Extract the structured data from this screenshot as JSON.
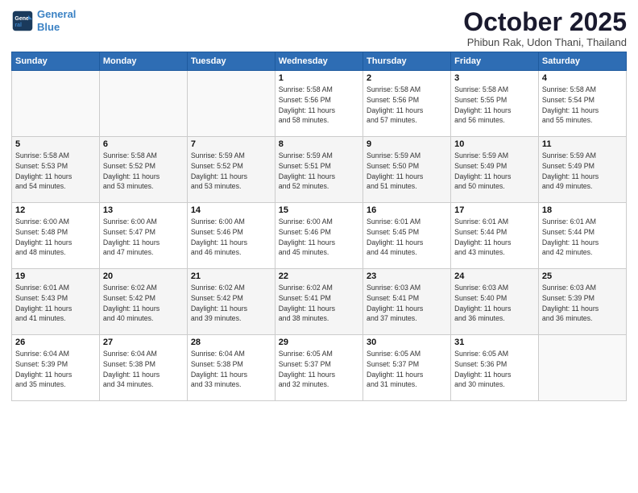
{
  "logo": {
    "line1": "General",
    "line2": "Blue"
  },
  "title": "October 2025",
  "subtitle": "Phibun Rak, Udon Thani, Thailand",
  "weekdays": [
    "Sunday",
    "Monday",
    "Tuesday",
    "Wednesday",
    "Thursday",
    "Friday",
    "Saturday"
  ],
  "weeks": [
    [
      {
        "day": "",
        "info": ""
      },
      {
        "day": "",
        "info": ""
      },
      {
        "day": "",
        "info": ""
      },
      {
        "day": "1",
        "info": "Sunrise: 5:58 AM\nSunset: 5:56 PM\nDaylight: 11 hours\nand 58 minutes."
      },
      {
        "day": "2",
        "info": "Sunrise: 5:58 AM\nSunset: 5:56 PM\nDaylight: 11 hours\nand 57 minutes."
      },
      {
        "day": "3",
        "info": "Sunrise: 5:58 AM\nSunset: 5:55 PM\nDaylight: 11 hours\nand 56 minutes."
      },
      {
        "day": "4",
        "info": "Sunrise: 5:58 AM\nSunset: 5:54 PM\nDaylight: 11 hours\nand 55 minutes."
      }
    ],
    [
      {
        "day": "5",
        "info": "Sunrise: 5:58 AM\nSunset: 5:53 PM\nDaylight: 11 hours\nand 54 minutes."
      },
      {
        "day": "6",
        "info": "Sunrise: 5:58 AM\nSunset: 5:52 PM\nDaylight: 11 hours\nand 53 minutes."
      },
      {
        "day": "7",
        "info": "Sunrise: 5:59 AM\nSunset: 5:52 PM\nDaylight: 11 hours\nand 53 minutes."
      },
      {
        "day": "8",
        "info": "Sunrise: 5:59 AM\nSunset: 5:51 PM\nDaylight: 11 hours\nand 52 minutes."
      },
      {
        "day": "9",
        "info": "Sunrise: 5:59 AM\nSunset: 5:50 PM\nDaylight: 11 hours\nand 51 minutes."
      },
      {
        "day": "10",
        "info": "Sunrise: 5:59 AM\nSunset: 5:49 PM\nDaylight: 11 hours\nand 50 minutes."
      },
      {
        "day": "11",
        "info": "Sunrise: 5:59 AM\nSunset: 5:49 PM\nDaylight: 11 hours\nand 49 minutes."
      }
    ],
    [
      {
        "day": "12",
        "info": "Sunrise: 6:00 AM\nSunset: 5:48 PM\nDaylight: 11 hours\nand 48 minutes."
      },
      {
        "day": "13",
        "info": "Sunrise: 6:00 AM\nSunset: 5:47 PM\nDaylight: 11 hours\nand 47 minutes."
      },
      {
        "day": "14",
        "info": "Sunrise: 6:00 AM\nSunset: 5:46 PM\nDaylight: 11 hours\nand 46 minutes."
      },
      {
        "day": "15",
        "info": "Sunrise: 6:00 AM\nSunset: 5:46 PM\nDaylight: 11 hours\nand 45 minutes."
      },
      {
        "day": "16",
        "info": "Sunrise: 6:01 AM\nSunset: 5:45 PM\nDaylight: 11 hours\nand 44 minutes."
      },
      {
        "day": "17",
        "info": "Sunrise: 6:01 AM\nSunset: 5:44 PM\nDaylight: 11 hours\nand 43 minutes."
      },
      {
        "day": "18",
        "info": "Sunrise: 6:01 AM\nSunset: 5:44 PM\nDaylight: 11 hours\nand 42 minutes."
      }
    ],
    [
      {
        "day": "19",
        "info": "Sunrise: 6:01 AM\nSunset: 5:43 PM\nDaylight: 11 hours\nand 41 minutes."
      },
      {
        "day": "20",
        "info": "Sunrise: 6:02 AM\nSunset: 5:42 PM\nDaylight: 11 hours\nand 40 minutes."
      },
      {
        "day": "21",
        "info": "Sunrise: 6:02 AM\nSunset: 5:42 PM\nDaylight: 11 hours\nand 39 minutes."
      },
      {
        "day": "22",
        "info": "Sunrise: 6:02 AM\nSunset: 5:41 PM\nDaylight: 11 hours\nand 38 minutes."
      },
      {
        "day": "23",
        "info": "Sunrise: 6:03 AM\nSunset: 5:41 PM\nDaylight: 11 hours\nand 37 minutes."
      },
      {
        "day": "24",
        "info": "Sunrise: 6:03 AM\nSunset: 5:40 PM\nDaylight: 11 hours\nand 36 minutes."
      },
      {
        "day": "25",
        "info": "Sunrise: 6:03 AM\nSunset: 5:39 PM\nDaylight: 11 hours\nand 36 minutes."
      }
    ],
    [
      {
        "day": "26",
        "info": "Sunrise: 6:04 AM\nSunset: 5:39 PM\nDaylight: 11 hours\nand 35 minutes."
      },
      {
        "day": "27",
        "info": "Sunrise: 6:04 AM\nSunset: 5:38 PM\nDaylight: 11 hours\nand 34 minutes."
      },
      {
        "day": "28",
        "info": "Sunrise: 6:04 AM\nSunset: 5:38 PM\nDaylight: 11 hours\nand 33 minutes."
      },
      {
        "day": "29",
        "info": "Sunrise: 6:05 AM\nSunset: 5:37 PM\nDaylight: 11 hours\nand 32 minutes."
      },
      {
        "day": "30",
        "info": "Sunrise: 6:05 AM\nSunset: 5:37 PM\nDaylight: 11 hours\nand 31 minutes."
      },
      {
        "day": "31",
        "info": "Sunrise: 6:05 AM\nSunset: 5:36 PM\nDaylight: 11 hours\nand 30 minutes."
      },
      {
        "day": "",
        "info": ""
      }
    ]
  ]
}
